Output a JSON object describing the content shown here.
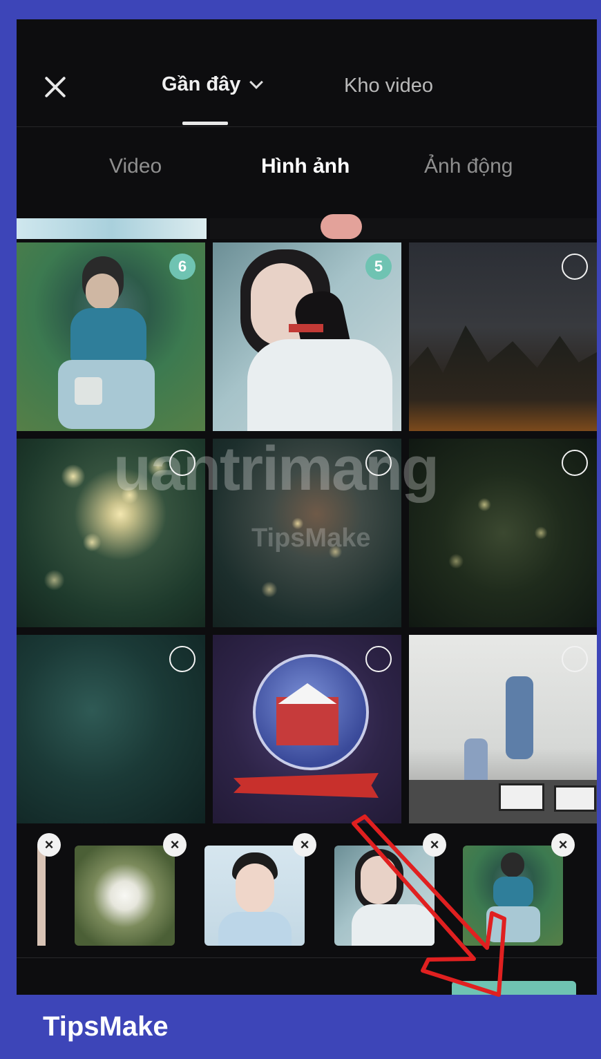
{
  "header": {
    "close_icon": "close-icon",
    "tab_recent": "Gần đây",
    "tab_recent_icon": "chevron-down-icon",
    "tab_stock": "Kho video"
  },
  "subtabs": {
    "video": "Video",
    "image": "Hình ảnh",
    "gif": "Ảnh động"
  },
  "grid": {
    "badges": [
      "6",
      "5"
    ]
  },
  "watermark": "uantrimang",
  "watermark_small": "TipsMake",
  "brand": "TipsMake",
  "colors": {
    "accent": "#6fc3b2",
    "frame": "#3d45b8",
    "annotation": "#e02020"
  }
}
